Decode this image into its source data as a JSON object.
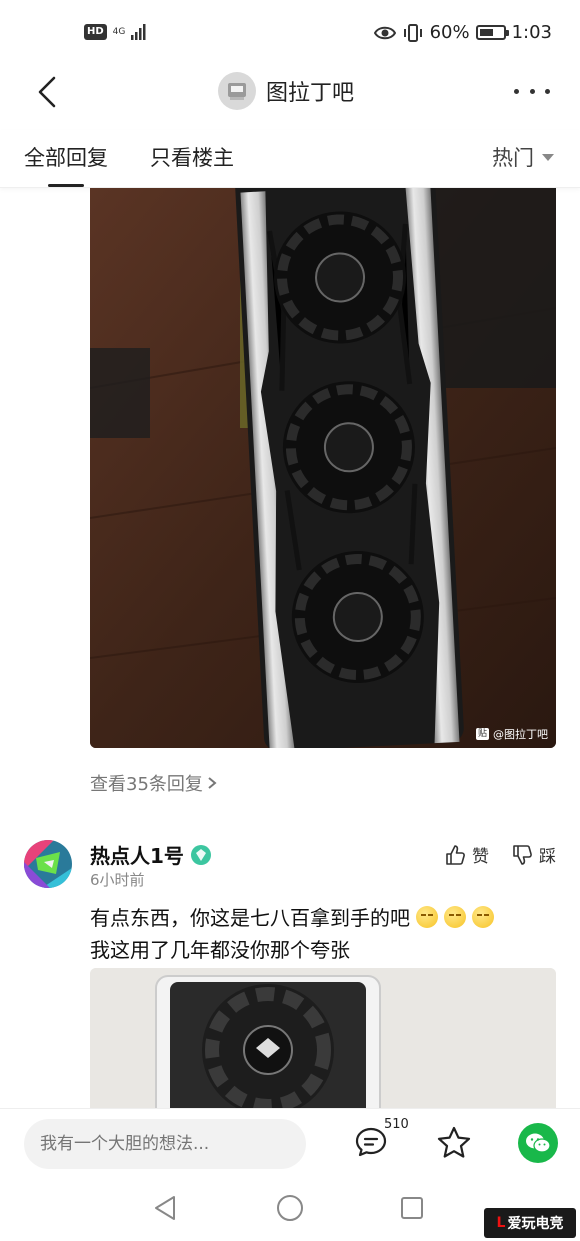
{
  "status_bar": {
    "hd": "HD",
    "network": "4G",
    "battery_text": "60%",
    "battery_level": 0.6,
    "time": "1:03"
  },
  "header": {
    "forum_name": "图拉丁吧",
    "back_icon": "chevron-left-icon",
    "more_icon": "more-dots-icon"
  },
  "tabs": {
    "all_replies": "全部回复",
    "owner_only": "只看楼主",
    "sort": "热门"
  },
  "post": {
    "watermark_tie": "贴",
    "watermark_text": "@图拉丁吧",
    "view_replies": "查看35条回复"
  },
  "comment": {
    "username": "热点人1号",
    "time": "6小时前",
    "like_label": "赞",
    "dislike_label": "踩",
    "text_line1": "有点东西，你这是七八百拿到手的吧",
    "text_line2": "我这用了几年都没你那个夸张"
  },
  "bottom_bar": {
    "input_placeholder": "我有一个大胆的想法...",
    "comment_count": "510"
  },
  "colors": {
    "wechat_green": "#19b84a",
    "verified_badge": "#3cc6a0",
    "text_primary": "#111111",
    "text_secondary": "#888888"
  }
}
